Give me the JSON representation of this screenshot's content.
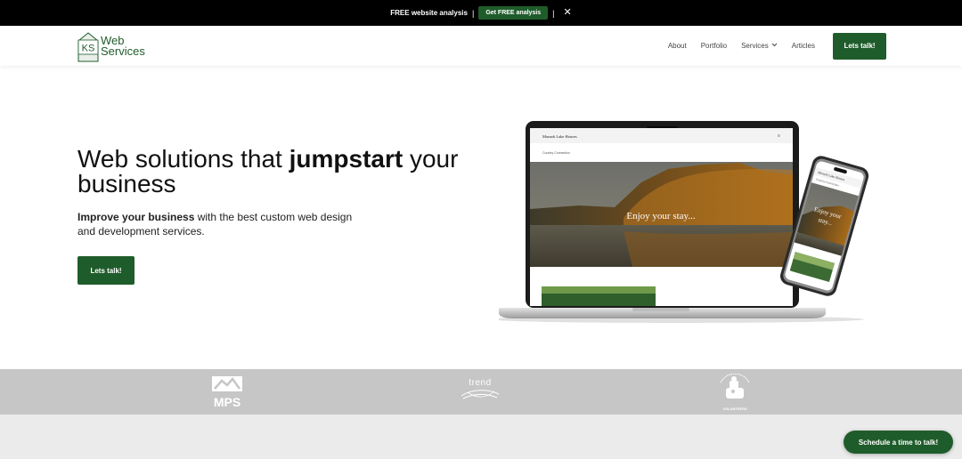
{
  "topbar": {
    "text": "FREE website analysis",
    "button_label": "Get FREE analysis",
    "close_glyph": "✕"
  },
  "header": {
    "logo": {
      "mark": "KS",
      "line1": "Web",
      "line2": "Services"
    },
    "nav": [
      {
        "label": "About"
      },
      {
        "label": "Portfolio"
      },
      {
        "label": "Services",
        "icon": "chevron-down-icon"
      },
      {
        "label": "Articles"
      }
    ],
    "cta_label": "Lets talk!"
  },
  "hero": {
    "title_pre": "Web solutions that ",
    "title_bold": "jumpstart",
    "title_post": " your business",
    "sub_bold": "Improve your business",
    "sub_rest": " with the best custom web design and development services.",
    "cta_label": "Lets talk!"
  },
  "mockup": {
    "laptop_site_title": "Monark Lake Houses",
    "laptop_site_sub": "Country Connection",
    "laptop_hero_text": "Enjoy your stay...",
    "phone_site_title": "Monark Lake Houses",
    "phone_site_sub": "Country Connection",
    "phone_hero_line1": "Enjoy your",
    "phone_hero_line2": "stay..."
  },
  "client_logos": {
    "mps": "MPS",
    "trend": "trend",
    "volunteers": "VOLUNTEERS"
  },
  "floating_cta": {
    "label": "Schedule a time to talk!"
  },
  "colors": {
    "brand_green": "#1f5c2b",
    "strip_gray": "#c6c6c6",
    "bottom_gray": "#ebebeb"
  }
}
